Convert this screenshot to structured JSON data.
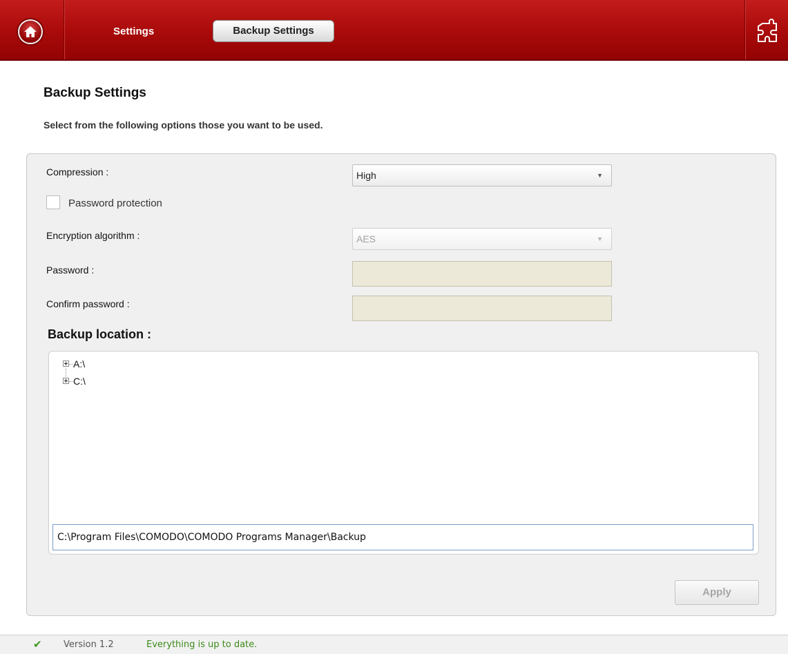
{
  "header": {
    "nav": {
      "settings_label": "Settings",
      "backup_settings_label": "Backup Settings"
    },
    "icons": {
      "home": "home-icon",
      "logo": "puzzle-icon"
    }
  },
  "page": {
    "title": "Backup Settings",
    "subtitle": "Select from the following options those you want to be used."
  },
  "form": {
    "compression": {
      "label": "Compression :",
      "value": "High"
    },
    "password_protection": {
      "label": "Password protection",
      "checked": false
    },
    "encryption": {
      "label": "Encryption algorithm :",
      "value": "AES"
    },
    "password": {
      "label": "Password :",
      "value": ""
    },
    "confirm_password": {
      "label": "Confirm password :",
      "value": ""
    }
  },
  "backup_location": {
    "title": "Backup location :",
    "tree": [
      {
        "label": "A:\\"
      },
      {
        "label": "C:\\"
      }
    ],
    "path": "C:\\Program Files\\COMODO\\COMODO Programs Manager\\Backup"
  },
  "actions": {
    "apply_label": "Apply"
  },
  "status": {
    "version": "Version 1.2",
    "message": "Everything is up to date.",
    "check_icon": "checkmark-icon"
  }
}
